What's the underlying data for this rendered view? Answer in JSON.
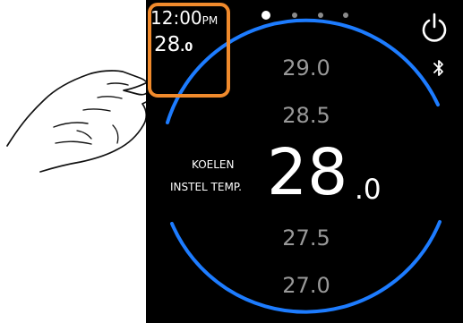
{
  "status": {
    "time": "12:00",
    "time_suffix": "PM",
    "power_icon": "power-icon",
    "bluetooth_icon": "bluetooth-icon"
  },
  "corner": {
    "temp_main": "28",
    "temp_decimal": ".0"
  },
  "pager": {
    "dots": 4,
    "active_index": 0
  },
  "mode": {
    "line1": "KOELEN",
    "line2": "INSTEL TEMP."
  },
  "setpoint": {
    "main": "28",
    "decimal": ".0",
    "list": [
      "29.0",
      "28.5",
      "27.5",
      "27.0"
    ]
  },
  "colors": {
    "ring": "#1d7cff",
    "highlight": "#f08a2c",
    "muted_text": "#999999"
  }
}
